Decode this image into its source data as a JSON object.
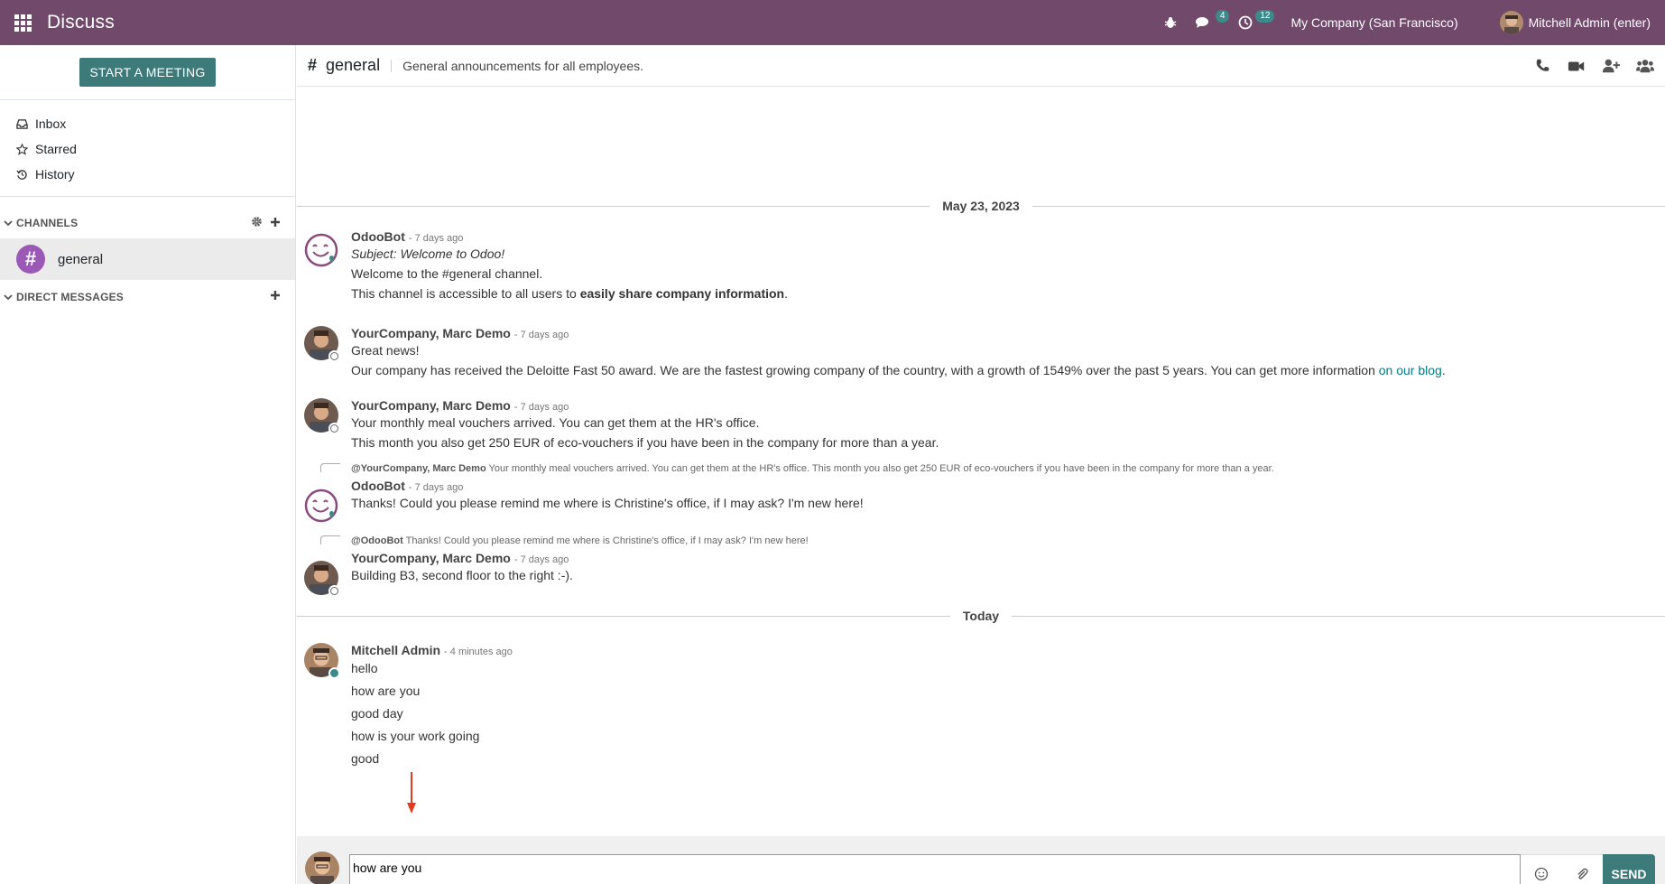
{
  "navbar": {
    "app_name": "Discuss",
    "messages_badge": "4",
    "activities_badge": "12",
    "company": "My Company (San Francisco)",
    "user": "Mitchell Admin (enter)",
    "bg_color": "#71496a"
  },
  "sidebar": {
    "start_meeting": "START A MEETING",
    "mailboxes": [
      {
        "label": "Inbox",
        "icon": "inbox-icon"
      },
      {
        "label": "Starred",
        "icon": "star-icon"
      },
      {
        "label": "History",
        "icon": "history-icon"
      }
    ],
    "channels_title": "CHANNELS",
    "channels": [
      {
        "name": "general",
        "icon": "#"
      }
    ],
    "dm_title": "DIRECT MESSAGES"
  },
  "header": {
    "name": "general",
    "description": "General announcements for all employees."
  },
  "thread": {
    "date1": "May 23, 2023",
    "date2": "Today",
    "messages": [
      {
        "author": "OdooBot",
        "time": "- 7 days ago",
        "subject": "Subject: Welcome to Odoo!",
        "line1": "Welcome to the #general channel.",
        "line2_prefix": "This channel is accessible to all users to ",
        "line2_bold": "easily share company information",
        "line2_suffix": "."
      },
      {
        "author": "YourCompany, Marc Demo",
        "time": "- 7 days ago",
        "line1": "Great news!",
        "line2_prefix": "Our company has received the Deloitte Fast 50 award. We are the fastest growing company of the country, with a growth of 1549% over the past 5 years. You can get more information ",
        "line2_link": "on our blog",
        "line2_suffix": "."
      },
      {
        "author": "YourCompany, Marc Demo",
        "time": "- 7 days ago",
        "line1": "Your monthly meal vouchers arrived. You can get them at the HR's office.",
        "line2": "This month you also get 250 EUR of eco-vouchers if you have been in the company for more than a year."
      },
      {
        "reply_author": "@YourCompany, Marc Demo",
        "reply_text": "Your monthly meal vouchers arrived. You can get them at the HR's office. This month you also get 250 EUR of eco-vouchers if you have been in the company for more than a year.",
        "author": "OdooBot",
        "time": "- 7 days ago",
        "line1": "Thanks! Could you please remind me where is Christine's office, if I may ask? I'm new here!"
      },
      {
        "reply_author": "@OdooBot",
        "reply_text": "Thanks! Could you please remind me where is Christine's office, if I may ask? I'm new here!",
        "author": "YourCompany, Marc Demo",
        "time": "- 7 days ago",
        "line1": "Building B3, second floor to the right :-)."
      },
      {
        "author": "Mitchell Admin",
        "time": "- 4 minutes ago",
        "lines": [
          "hello",
          "how are you",
          "good day",
          "how is your work going",
          "good"
        ]
      }
    ]
  },
  "composer": {
    "value": "how are you",
    "send": "SEND"
  }
}
